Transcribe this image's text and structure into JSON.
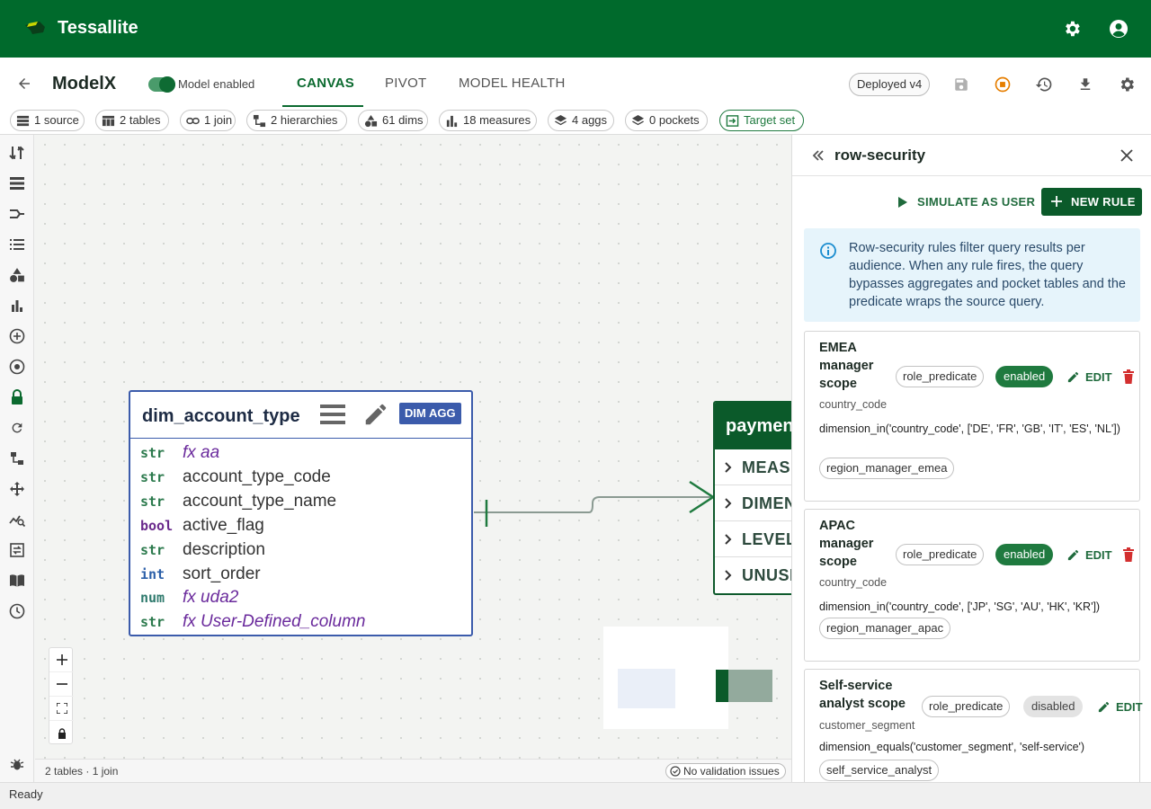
{
  "app": {
    "title": "Tessallite"
  },
  "model": {
    "name": "ModelX",
    "enabled_label": "Model enabled",
    "tabs": [
      {
        "label": "CANVAS",
        "active": true
      },
      {
        "label": "PIVOT",
        "active": false
      },
      {
        "label": "MODEL HEALTH",
        "active": false
      }
    ],
    "deploy_label": "Deployed v4"
  },
  "summary_chips": [
    {
      "label": "1 source",
      "icon": "list-icon"
    },
    {
      "label": "2 tables",
      "icon": "table-icon"
    },
    {
      "label": "1 join",
      "icon": "link-icon"
    },
    {
      "label": "2 hierarchies",
      "icon": "hierarchy-icon"
    },
    {
      "label": "61 dims",
      "icon": "shapes-icon"
    },
    {
      "label": "18 measures",
      "icon": "bar-chart-icon"
    },
    {
      "label": "4 aggs",
      "icon": "layers-icon"
    },
    {
      "label": "0 pockets",
      "icon": "layers-icon"
    },
    {
      "label": "Target set",
      "icon": "target-export-icon"
    }
  ],
  "canvas": {
    "table": {
      "name": "dim_account_type",
      "badge": "DIM AGG",
      "columns": [
        {
          "type": "str",
          "name": "fx aa",
          "computed": true
        },
        {
          "type": "str",
          "name": "account_type_code",
          "computed": false
        },
        {
          "type": "str",
          "name": "account_type_name",
          "computed": false
        },
        {
          "type": "bool",
          "name": "active_flag",
          "computed": false
        },
        {
          "type": "str",
          "name": "description",
          "computed": false
        },
        {
          "type": "int",
          "name": "sort_order",
          "computed": false
        },
        {
          "type": "num",
          "name": "fx uda2",
          "computed": true
        },
        {
          "type": "str",
          "name": "fx User-Defined_column",
          "computed": true
        }
      ]
    },
    "payment_table": {
      "name": "paymen",
      "sections": [
        "MEASU",
        "DIMEN",
        "LEVEL",
        "UNUSI"
      ]
    },
    "footer_stats": "2 tables · 1 join",
    "validation": "No validation issues"
  },
  "panel": {
    "title": "row-security",
    "simulate_label": "SIMULATE AS USER",
    "new_rule_label": "NEW RULE",
    "info": "Row-security rules filter query results per audience. When any rule fires, the query bypasses aggregates and pocket tables and the predicate wraps the source query.",
    "edit_label": "EDIT",
    "rules": [
      {
        "name": "EMEA manager scope",
        "type": "role_predicate",
        "status": "enabled",
        "dimension": "country_code",
        "expression": "dimension_in('country_code', ['DE', 'FR', 'GB', 'IT', 'ES', 'NL'])",
        "role": "region_manager_emea"
      },
      {
        "name": "APAC manager scope",
        "type": "role_predicate",
        "status": "enabled",
        "dimension": "country_code",
        "expression": "dimension_in('country_code', ['JP', 'SG', 'AU', 'HK', 'KR'])",
        "role": "region_manager_apac"
      },
      {
        "name": "Self-service analyst scope",
        "type": "role_predicate",
        "status": "disabled",
        "dimension": "customer_segment",
        "expression": "dimension_equals('customer_segment', 'self-service')",
        "role": "self_service_analyst"
      }
    ]
  },
  "status_bar": {
    "text": "Ready"
  },
  "colors": {
    "brand": "#006a2c",
    "accent": "#0b5a2a",
    "table_border": "#3b5bab",
    "danger": "#d32f2f",
    "warning": "#e67e00"
  }
}
